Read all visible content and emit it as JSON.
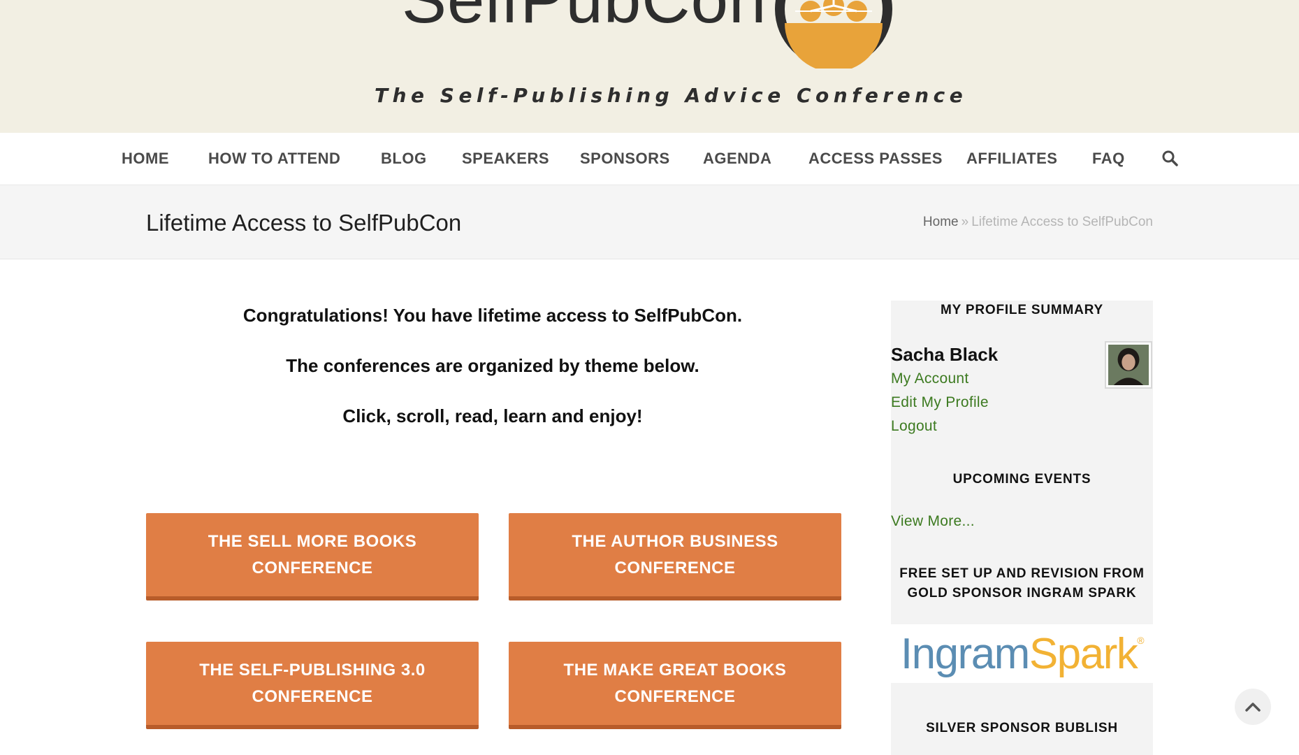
{
  "header": {
    "logo_text": "SelfPubCon",
    "tagline": "The Self-Publishing Advice Conference"
  },
  "nav": {
    "items": [
      {
        "label": "HOME"
      },
      {
        "label": "HOW TO ATTEND"
      },
      {
        "label": "BLOG"
      },
      {
        "label": "SPEAKERS"
      },
      {
        "label": "SPONSORS"
      },
      {
        "label": "AGENDA"
      },
      {
        "label": "ACCESS PASSES"
      },
      {
        "label": "AFFILIATES"
      },
      {
        "label": "FAQ"
      }
    ],
    "search_icon": "search-icon"
  },
  "titlebar": {
    "title": "Lifetime Access to SelfPubCon",
    "breadcrumb_home": "Home",
    "breadcrumb_sep": "»",
    "breadcrumb_current": "Lifetime Access to SelfPubCon"
  },
  "main": {
    "intro": [
      "Congratulations! You have lifetime access to SelfPubCon.",
      "The conferences are organized by theme below.",
      "Click, scroll, read, learn and enjoy!"
    ],
    "conference_buttons": [
      {
        "line1": "THE SELL MORE BOOKS",
        "line2": "CONFERENCE"
      },
      {
        "line1": "THE AUTHOR BUSINESS",
        "line2": "CONFERENCE"
      },
      {
        "line1": "THE SELF-PUBLISHING 3.0",
        "line2": "CONFERENCE"
      },
      {
        "line1": "THE MAKE GREAT BOOKS",
        "line2": "CONFERENCE"
      }
    ]
  },
  "sidebar": {
    "profile_heading": "MY PROFILE SUMMARY",
    "profile_name": "Sacha Black",
    "links": {
      "my_account": "My Account",
      "edit_profile": "Edit My Profile",
      "logout": "Logout"
    },
    "events_heading": "UPCOMING EVENTS",
    "view_more": "View More...",
    "gold_heading_line1": "FREE SET UP AND REVISION FROM",
    "gold_heading_line2": "GOLD SPONSOR INGRAM SPARK",
    "ingram_logo_a": "Ingram",
    "ingram_logo_b": "Spark",
    "ingram_logo_r": "®",
    "silver_heading": "SILVER SPONSOR BUBLISH"
  },
  "colors": {
    "banner_bg": "#f2efe3",
    "button_orange": "#e07e45",
    "link_green": "#3c7a20",
    "logo_orange": "#e8a33a"
  },
  "icons": {
    "scroll_top": "chevron-up-icon"
  }
}
